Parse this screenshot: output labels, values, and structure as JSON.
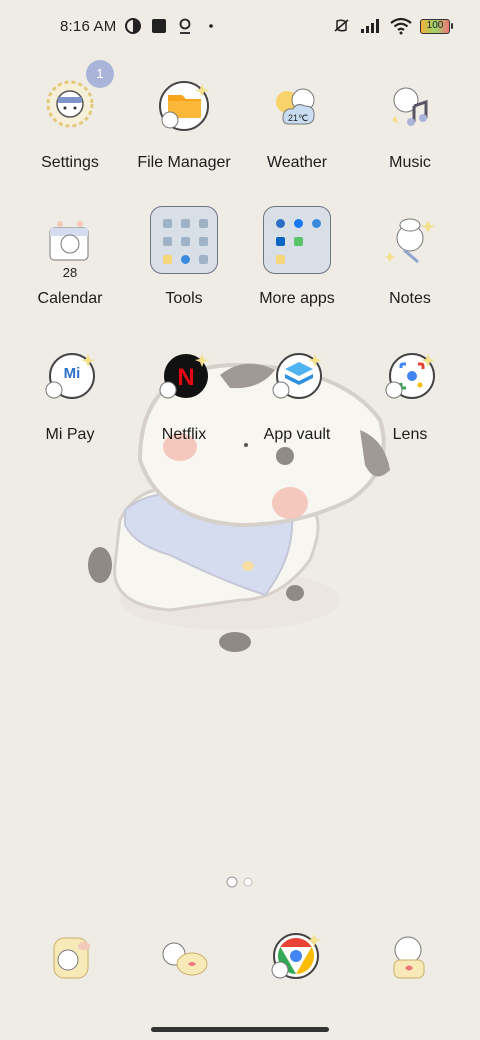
{
  "status": {
    "time": "8:16 AM",
    "battery": "100",
    "left_icons": [
      "data-saver-icon",
      "square-notification-icon",
      "location-pin-icon",
      "dot-icon"
    ],
    "right_icons": [
      "vibrate-off-icon",
      "signal-icon",
      "wifi-icon",
      "battery-icon"
    ]
  },
  "apps": [
    {
      "label": "Settings",
      "icon": "settings-cat-icon",
      "badge": "1"
    },
    {
      "label": "File Manager",
      "icon": "folder-cat-icon"
    },
    {
      "label": "Weather",
      "icon": "weather-cat-icon",
      "temp": "21℃"
    },
    {
      "label": "Music",
      "icon": "music-cat-icon"
    },
    {
      "label": "Calendar",
      "icon": "calendar-cat-icon",
      "date": "28"
    },
    {
      "label": "Tools",
      "icon": "folder-icon"
    },
    {
      "label": "More apps",
      "icon": "folder-icon"
    },
    {
      "label": "Notes",
      "icon": "notes-cat-icon"
    },
    {
      "label": "Mi Pay",
      "icon": "mipay-cat-icon",
      "mark": "Mi"
    },
    {
      "label": "Netflix",
      "icon": "netflix-cat-icon",
      "mark": "N"
    },
    {
      "label": "App vault",
      "icon": "app-vault-cat-icon"
    },
    {
      "label": "Lens",
      "icon": "lens-cat-icon"
    }
  ],
  "dock": [
    {
      "icon": "phone-cat-icon"
    },
    {
      "icon": "messages-cat-icon"
    },
    {
      "icon": "chrome-cat-icon"
    },
    {
      "icon": "camera-cat-icon"
    }
  ],
  "colors": {
    "background": "#efebe5",
    "badge": "#aab4d8",
    "netflix_red": "#e50914",
    "folder_bg": "#d8dfe6"
  }
}
